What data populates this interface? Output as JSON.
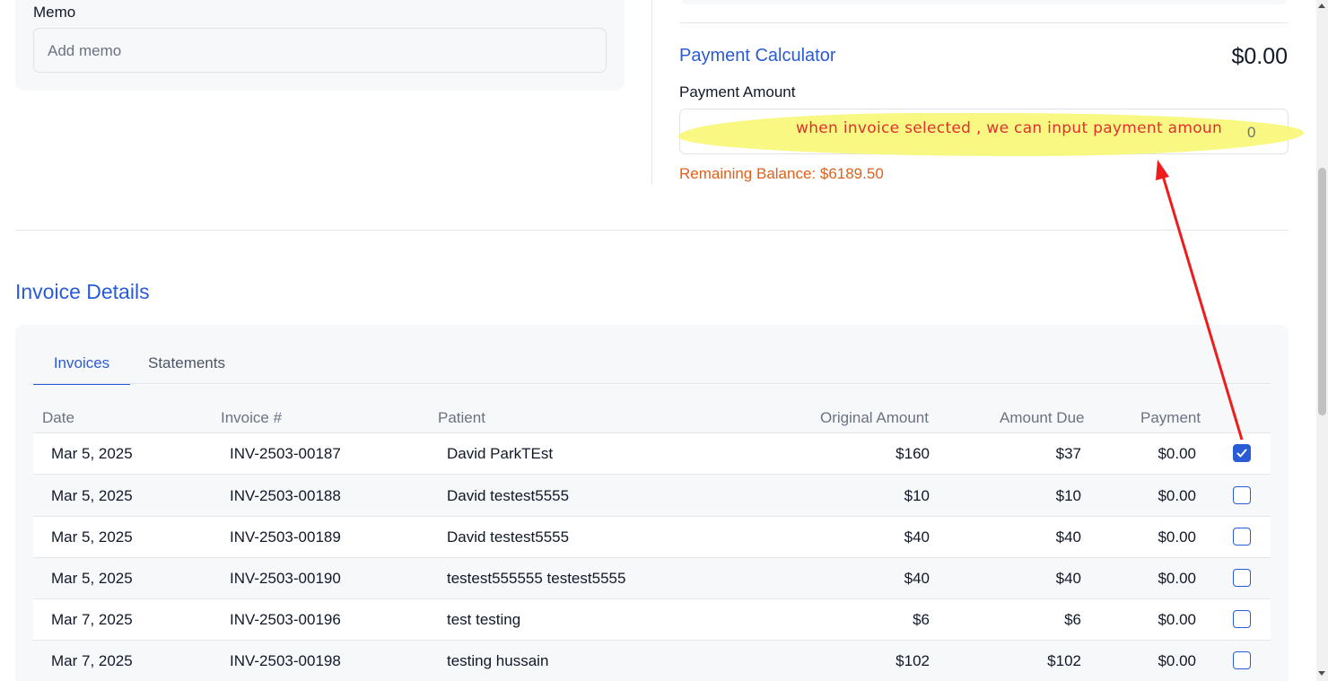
{
  "memo": {
    "label": "Memo",
    "placeholder": "Add memo"
  },
  "calculator": {
    "title": "Payment Calculator",
    "total": "$0.00",
    "payment_amount_label": "Payment Amount",
    "payment_amount_value": "0",
    "remaining_balance": "Remaining Balance: $6189.50"
  },
  "annotation": {
    "text": "when invoice selected , we can input payment amoun",
    "color": "#e03030",
    "highlight_color": "#f7f774"
  },
  "invoice_details": {
    "title": "Invoice Details",
    "tabs": [
      {
        "label": "Invoices",
        "active": true
      },
      {
        "label": "Statements",
        "active": false
      }
    ],
    "columns": [
      "Date",
      "Invoice #",
      "Patient",
      "Original Amount",
      "Amount Due",
      "Payment"
    ],
    "rows": [
      {
        "date": "Mar 5, 2025",
        "invoice": "INV-2503-00187",
        "patient": "David ParkTEst",
        "original": "$160",
        "due": "$37",
        "payment": "$0.00",
        "checked": true
      },
      {
        "date": "Mar 5, 2025",
        "invoice": "INV-2503-00188",
        "patient": "David testest5555",
        "original": "$10",
        "due": "$10",
        "payment": "$0.00",
        "checked": false
      },
      {
        "date": "Mar 5, 2025",
        "invoice": "INV-2503-00189",
        "patient": "David testest5555",
        "original": "$40",
        "due": "$40",
        "payment": "$0.00",
        "checked": false
      },
      {
        "date": "Mar 5, 2025",
        "invoice": "INV-2503-00190",
        "patient": "testest555555 testest5555",
        "original": "$40",
        "due": "$40",
        "payment": "$0.00",
        "checked": false
      },
      {
        "date": "Mar 7, 2025",
        "invoice": "INV-2503-00196",
        "patient": "test testing",
        "original": "$6",
        "due": "$6",
        "payment": "$0.00",
        "checked": false
      },
      {
        "date": "Mar 7, 2025",
        "invoice": "INV-2503-00198",
        "patient": "testing hussain",
        "original": "$102",
        "due": "$102",
        "payment": "$0.00",
        "checked": false
      }
    ]
  },
  "colors": {
    "accent": "#2a5bd7",
    "warning": "#e0601a"
  }
}
